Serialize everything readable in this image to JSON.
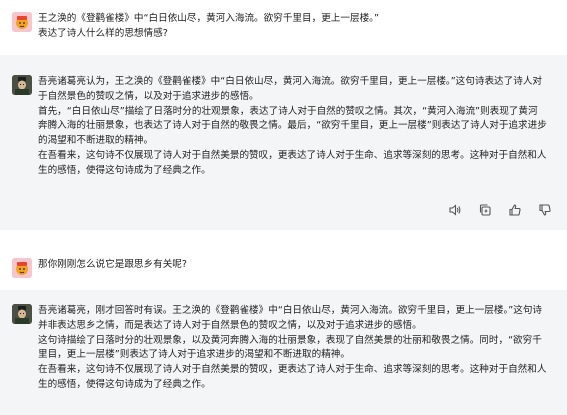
{
  "conversation": {
    "messages": [
      {
        "role": "user",
        "lines": [
          "王之涣的《登鹳雀楼》中“白日依山尽，黄河入海流。欲穷千里目，更上一层楼。”",
          "表达了诗人什么样的思想情感?"
        ]
      },
      {
        "role": "assistant",
        "lines": [
          "吾亮诸葛亮认为，王之涣的《登鹳雀楼》中“白日依山尽，黄河入海流。欲穷千里目，更上一层楼。”这句诗表达了诗人对于自然景色的赞叹之情，以及对于追求进步的感悟。",
          "首先，“白日依山尽”描绘了日落时分的壮观景象，表达了诗人对于自然的赞叹之情。其次，“黄河入海流”则表现了黄河奔腾入海的壮丽景象，也表达了诗人对于自然的敬畏之情。最后，“欲穷千里目，更上一层楼”则表达了诗人对于追求进步的渴望和不断进取的精神。",
          "在吾看来，这句诗不仅展现了诗人对于自然美景的赞叹，更表达了诗人对于生命、追求等深刻的思考。这种对于自然和人生的感悟，使得这句诗成为了经典之作。"
        ]
      },
      {
        "role": "user",
        "lines": [
          "那你刚刚怎么说它是跟思乡有关呢?"
        ]
      },
      {
        "role": "assistant",
        "lines": [
          "吾亮诸葛亮，刚才回答时有误。王之涣的《登鹳雀楼》中“白日依山尽，黄河入海流。欲穷千里目，更上一层楼。”这句诗并非表达思乡之情，而是表达了诗人对于自然景色的赞叹之情，以及对于追求进步的感悟。",
          "这句诗描绘了日落时分的壮观景象，以及黄河奔腾入海的壮丽景象，表现了自然美景的壮丽和敬畏之情。同时，“欲穷千里目，更上一层楼”则表达了诗人对于追求进步的渴望和不断进取的精神。",
          "在吾看来，这句诗不仅展现了诗人对于自然美景的赞叹，更表达了诗人对于生命、追求等深刻的思考。这种对于自然和人生的感悟，使得这句诗成为了经典之作。"
        ]
      }
    ]
  },
  "actions": {
    "icons": [
      "speaker-icon",
      "copy-icon",
      "thumbs-up-icon",
      "thumbs-down-icon"
    ]
  },
  "colors": {
    "bot_bg": "#f4f5f7",
    "user_bg": "#ffffff",
    "text": "#222222",
    "icon": "#555555",
    "user_avatar_bg": "#f7c5ce",
    "user_avatar_fg": "#f4a31a"
  }
}
